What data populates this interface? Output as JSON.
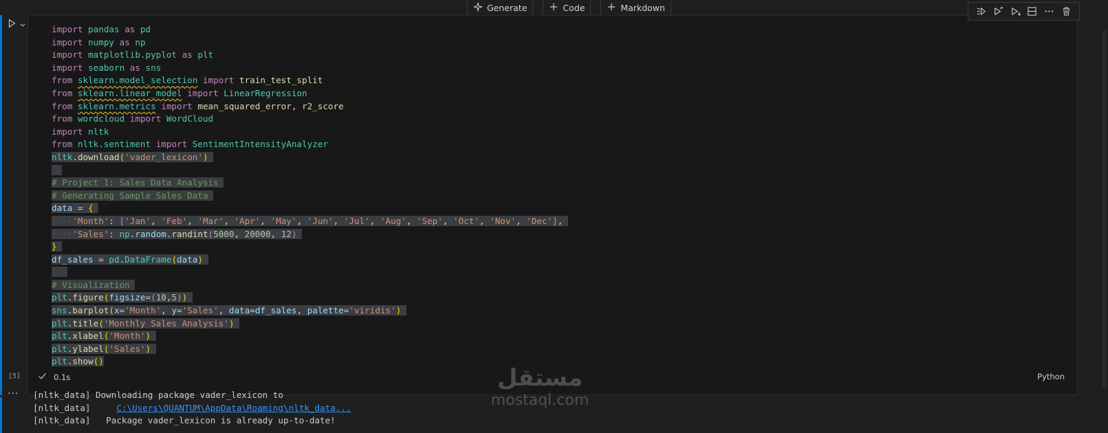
{
  "insert_toolbar": {
    "generate_label": "Generate",
    "code_label": "Code",
    "markdown_label": "Markdown"
  },
  "cell": {
    "execution_count": "[5]",
    "status_time": "0.1s",
    "language": "Python",
    "toolbar_icons": [
      "run-by-line-icon",
      "execute-above-icon",
      "execute-below-icon",
      "split-cell-icon",
      "more-actions-icon",
      "delete-cell-icon"
    ]
  },
  "code_lines": [
    "import pandas as pd",
    "import numpy as np",
    "import matplotlib.pyplot as plt",
    "import seaborn as sns",
    "from sklearn.model_selection import train_test_split",
    "from sklearn.linear_model import LinearRegression",
    "from sklearn.metrics import mean_squared_error, r2_score",
    "from wordcloud import WordCloud",
    "import nltk",
    "from nltk.sentiment import SentimentIntensityAnalyzer",
    "nltk.download('vader_lexicon')",
    "",
    "# Project 1: Sales Data Analysis",
    "# Generating Sample Sales Data",
    "data = {",
    "    'Month': ['Jan', 'Feb', 'Mar', 'Apr', 'May', 'Jun', 'Jul', 'Aug', 'Sep', 'Oct', 'Nov', 'Dec'],",
    "    'Sales': np.random.randint(5000, 20000, 12)",
    "}",
    "df_sales = pd.DataFrame(data)",
    "",
    "# Visualization",
    "plt.figure(figsize=(10,5))",
    "sns.barplot(x='Month', y='Sales', data=df_sales, palette='viridis')",
    "plt.title('Monthly Sales Analysis')",
    "plt.xlabel('Month')",
    "plt.ylabel('Sales')",
    "plt.show()"
  ],
  "output": {
    "line1": "[nltk_data] Downloading package vader_lexicon to",
    "line2_prefix": "[nltk_data]     ",
    "line2_link": "C:\\Users\\QUANTUM\\AppData\\Roaming\\nltk_data...",
    "line3": "[nltk_data]   Package vader_lexicon is already up-to-date!"
  },
  "watermark": {
    "logo": "مستقل",
    "text": "mostaql.com"
  }
}
